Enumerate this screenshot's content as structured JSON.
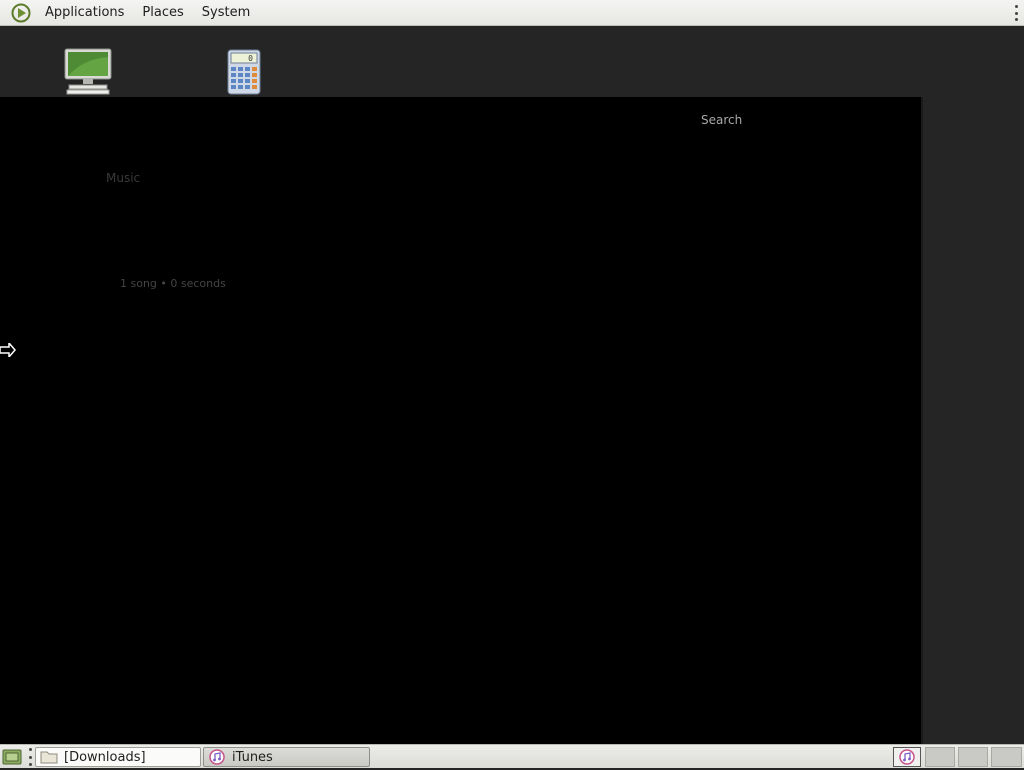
{
  "top_panel": {
    "menus": [
      "Applications",
      "Places",
      "System"
    ]
  },
  "desktop": {
    "icons": [
      "computer-icon",
      "calculator-icon"
    ]
  },
  "app_window": {
    "app_name": "iTunes",
    "search_label": "Search",
    "section_title": "Music",
    "song_summary": "1 song • 0 seconds"
  },
  "taskbar": {
    "tasks": [
      {
        "label": "[Downloads]",
        "icon": "folder-icon"
      },
      {
        "label": "iTunes",
        "icon": "itunes-icon"
      }
    ]
  },
  "colors": {
    "window_bg": "#000000",
    "desktop_bg": "#252525",
    "panel_bg": "#ececea"
  }
}
